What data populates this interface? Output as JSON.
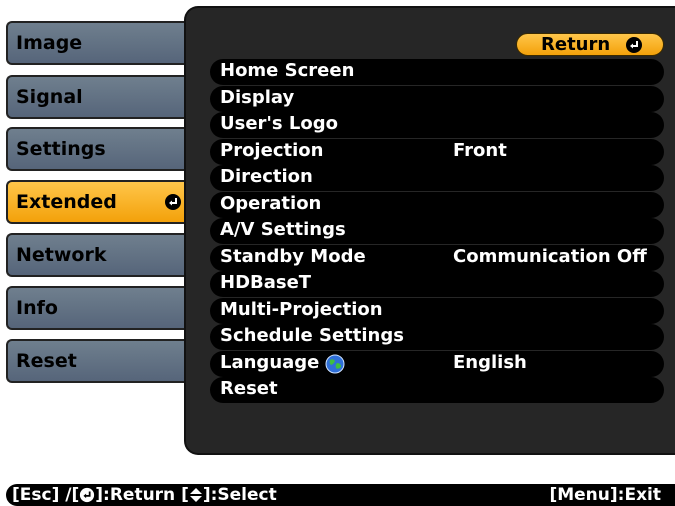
{
  "tabs": [
    {
      "label": "Image",
      "active": false
    },
    {
      "label": "Signal",
      "active": false
    },
    {
      "label": "Settings",
      "active": false
    },
    {
      "label": "Extended",
      "active": true
    },
    {
      "label": "Network",
      "active": false
    },
    {
      "label": "Info",
      "active": false
    },
    {
      "label": "Reset",
      "active": false
    }
  ],
  "return_button": {
    "label": "Return"
  },
  "menu": [
    {
      "label": "Home Screen",
      "value": ""
    },
    {
      "label": "Display",
      "value": ""
    },
    {
      "label": "User's Logo",
      "value": ""
    },
    {
      "label": "Projection",
      "value": "Front"
    },
    {
      "label": "Direction",
      "value": ""
    },
    {
      "label": "Operation",
      "value": ""
    },
    {
      "label": "A/V Settings",
      "value": ""
    },
    {
      "label": "Standby Mode",
      "value": "Communication Off"
    },
    {
      "label": "HDBaseT",
      "value": ""
    },
    {
      "label": "Multi-Projection",
      "value": ""
    },
    {
      "label": "Schedule Settings",
      "value": ""
    },
    {
      "label": "Language",
      "value": "English",
      "icon": "globe-icon"
    },
    {
      "label": "Reset",
      "value": ""
    }
  ],
  "footer": {
    "esc": "[Esc] /[",
    "return": "]:Return  [",
    "select": "]:Select",
    "exit": "[Menu]:Exit"
  },
  "colors": {
    "tab_default": "#64748a",
    "tab_active": "#f7b126",
    "panel_bg": "#262626",
    "item_bg": "#000000"
  },
  "icons": {
    "enter": "enter-icon",
    "updown": "up-down-arrow-icon",
    "globe": "globe-icon"
  }
}
